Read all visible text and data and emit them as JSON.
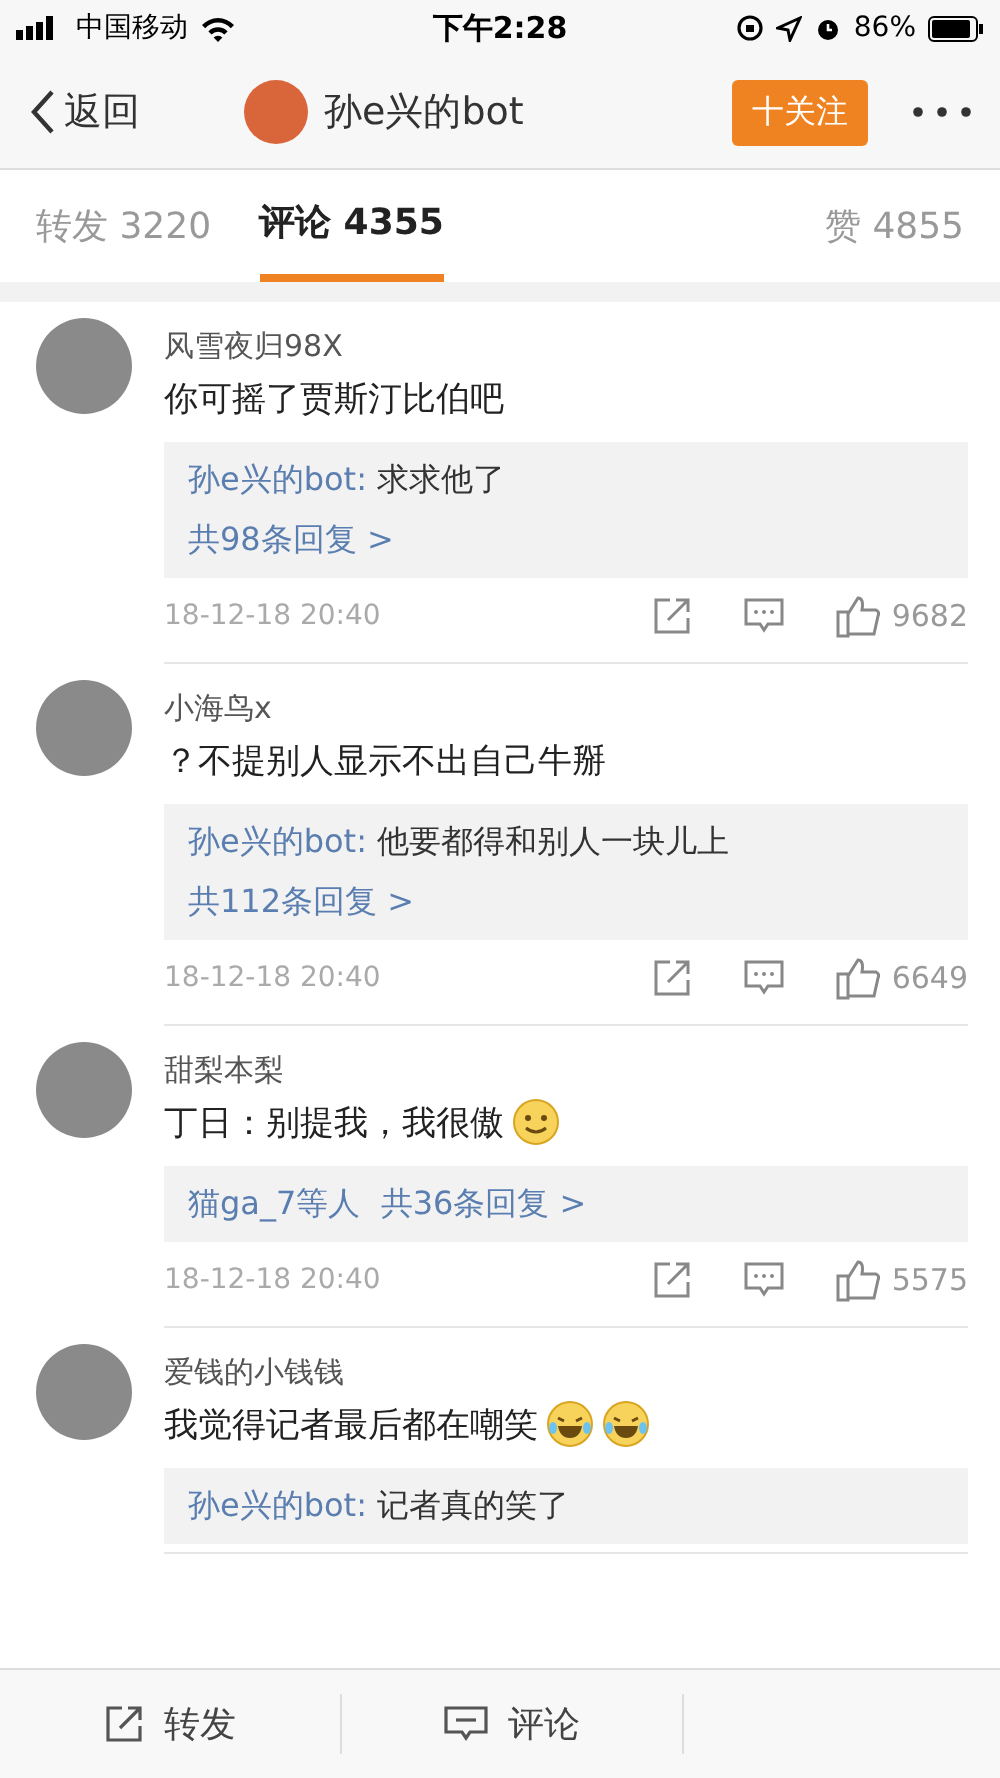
{
  "status_bar": {
    "carrier": "中国移动",
    "time": "下午2:28",
    "battery": "86%"
  },
  "nav": {
    "back": "返回",
    "title": "孙e兴的bot",
    "follow": "十关注"
  },
  "tabs": [
    {
      "label": "转发 3220",
      "selected": false
    },
    {
      "label": "评论 4355",
      "selected": true
    },
    {
      "label": "赞 4855",
      "selected": false
    }
  ],
  "comments": [
    {
      "name": "风雪夜归98X",
      "text": "你可摇了贾斯汀比伯吧",
      "reply": {
        "author": "孙e兴的bot:",
        "text": "求求他了",
        "more": "共98条回复 >"
      },
      "time": "18-12-18 20:40",
      "likes": "9682"
    },
    {
      "name": "小海鸟x",
      "text": "？不提别人显示不出自己牛掰",
      "reply": {
        "author": "孙e兴的bot:",
        "text": "他要都得和别人一块儿上",
        "more": "共112条回复 >"
      },
      "time": "18-12-18 20:40",
      "likes": "6649"
    },
    {
      "name": "甜梨本梨",
      "text": "丁日：别提我，我很傲",
      "emojis": [
        {
          "kind": "smile"
        }
      ],
      "reply": {
        "users": "猫ga_7等人",
        "more": "共36条回复 >"
      },
      "time": "18-12-18 20:40",
      "likes": "5575"
    },
    {
      "name": "爱钱的小钱钱",
      "text": "我觉得记者最后都在嘲笑",
      "emojis": [
        {
          "kind": "laugh"
        },
        {
          "kind": "laugh"
        }
      ],
      "reply": {
        "author": "孙e兴的bot:",
        "text": "记者真的笑了"
      }
    }
  ],
  "bottom_bar": [
    {
      "kind": "repost",
      "label": "转发"
    },
    {
      "kind": "comment",
      "label": "评论"
    }
  ]
}
